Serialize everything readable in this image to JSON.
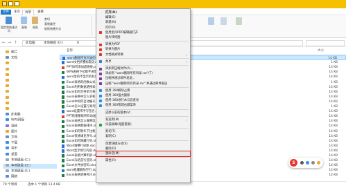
{
  "ribbon_tabs": [
    "文件",
    "主页",
    "共享",
    "查看"
  ],
  "ribbon": {
    "pin_label": "固定到快速访问",
    "copy_label": "复制",
    "paste_label": "粘贴",
    "cut_label": "剪切",
    "copy_path_label": "复制路径",
    "paste_shortcut_label": "粘贴快捷方式"
  },
  "address": {
    "path": [
      "此电脑",
      "本地磁盘 (D:)",
      "8"
    ]
  },
  "nav_pane": [
    {
      "label": "图片",
      "color": "#e8a92e"
    },
    {
      "label": "文档",
      "color": "#6f8fb3"
    },
    {
      "label": "",
      "color": "#e8a92e"
    },
    {
      "label": "",
      "color": "#e8a92e"
    },
    {
      "label": "",
      "color": "#e8a92e"
    },
    {
      "label": "",
      "color": "#e8a92e"
    },
    {
      "label": "",
      "color": "#e8a92e"
    },
    {
      "label": "",
      "color": "#e8a92e"
    },
    {
      "label": "",
      "color": "#e8a92e"
    },
    {
      "label": "",
      "color": "#e8a92e"
    },
    {
      "label": "",
      "color": "#e8a92e"
    },
    {
      "label": "此电脑",
      "color": "#4a90d9"
    },
    {
      "label": "WPS网盘",
      "color": "#3a8ee6"
    },
    {
      "label": "视频",
      "color": "#8a6fd1"
    },
    {
      "label": "图片",
      "color": "#e8a92e"
    },
    {
      "label": "文档",
      "color": "#6f8fb3"
    },
    {
      "label": "下载",
      "color": "#3a8ee6"
    },
    {
      "label": "音乐",
      "color": "#3a8ee6"
    },
    {
      "label": "桌面",
      "color": "#3a8ee6"
    },
    {
      "label": "本地磁盘 (C:)",
      "color": "#9aa7b3"
    },
    {
      "label": "本地磁盘 (D:)",
      "color": "#9aa7b3",
      "selected": true
    },
    {
      "label": "本地磁盘 (E:)",
      "color": "#9aa7b3"
    },
    {
      "label": "网络",
      "color": "#4a90d9"
    }
  ],
  "columns": {
    "name": "名称",
    "size": "大小"
  },
  "files": [
    {
      "name": "word删除所有目录的...docx",
      "size": "14 KB",
      "color": "#2b6fd6",
      "selected": true
    },
    {
      "name": "word文档折叠标题怎么.docx",
      "size": "1 KB",
      "color": "#2b6fd6"
    },
    {
      "name": "PPT如何添加超链接.pptx",
      "size": "14 KB",
      "color": "#d24726"
    },
    {
      "name": "WPS表格下拉数字递增.xlsx",
      "size": "14 KB",
      "color": "#1e7e45"
    },
    {
      "name": "word里的不显示的标记.docx",
      "size": "14 KB",
      "color": "#2b6fd6"
    },
    {
      "name": "Excel表格的函数公式.xlsx",
      "size": "1 KB",
      "color": "#1e7e45"
    },
    {
      "name": "Excel利用数据透视表.xlsx",
      "size": "14 KB",
      "color": "#1e7e45"
    },
    {
      "name": "Excel如何合并单元格.xlsx",
      "size": "14 KB",
      "color": "#1e7e45"
    },
    {
      "name": "excel表格中怎么求和.xlsx",
      "size": "14 KB",
      "color": "#1e7e45"
    },
    {
      "name": "Excel中如何自动编号.xlsx",
      "size": "14 KB",
      "color": "#1e7e45"
    },
    {
      "name": "Excel怎么设置行高列宽.xlsx",
      "size": "1 KB",
      "color": "#1e7e45"
    },
    {
      "name": "word设置带手写签名.docx",
      "size": "14 KB",
      "color": "#2b6fd6"
    },
    {
      "name": "PPT快速删除所有动画.pptx",
      "size": "14 KB",
      "color": "#d24726"
    },
    {
      "name": "Excel表格怎么做筛选.xlsx",
      "size": "14 KB",
      "color": "#1e7e45"
    },
    {
      "name": "Excel表格数据排序.xlsx",
      "size": "14 KB",
      "color": "#1e7e45"
    },
    {
      "name": "Excel如何制作下拉框.xlsx",
      "size": "14 KB",
      "color": "#1e7e45"
    },
    {
      "name": "Excel快速填充序号.xlsx",
      "size": "14 KB",
      "color": "#1e7e45"
    },
    {
      "name": "Excel如何隐藏行列.xlsx",
      "size": "14 KB",
      "color": "#1e7e45"
    },
    {
      "name": "Word调整行间距.docx",
      "size": "14 KB",
      "color": "#2b6fd6"
    },
    {
      "name": "Word显示修订内容.docx",
      "size": "14 KB",
      "color": "#2b6fd6"
    },
    {
      "name": "excel表格计算年龄.xlsx",
      "size": "14 KB",
      "color": "#1e7e45"
    },
    {
      "name": "Excel冻结首行首列.xlsx",
      "size": "14 KB",
      "color": "#1e7e45"
    },
    {
      "name": "Excel文件加密码.xlsx",
      "size": "14 KB",
      "color": "#1e7e45"
    },
    {
      "name": "word批量删除空行.docx",
      "size": "14 KB",
      "color": "#2b6fd6"
    },
    {
      "name": "Excel表格转换PDF.xlsx",
      "size": "14 KB",
      "color": "#1e7e45"
    }
  ],
  "statusbar": {
    "count": "79 个项目",
    "selected": "选中 1 个项目 13.4 KB"
  },
  "context_menu": [
    {
      "label": "打开(O)",
      "icon": "",
      "bold": true
    },
    {
      "label": "编辑(E)",
      "icon": ""
    },
    {
      "label": "新建(N)",
      "icon": ""
    },
    {
      "label": "打印(P)",
      "icon": ""
    },
    {
      "label": "使用金舟PDF编辑器打开",
      "icon": "#d83b2d"
    },
    {
      "label": "图片转纯图",
      "icon": ""
    },
    {
      "sep": true
    },
    {
      "label": "转换为PDF",
      "icon": "#d83b2d"
    },
    {
      "label": "转换为图片",
      "icon": "#d83b2d"
    },
    {
      "label": "文档格式转换",
      "icon": "#d83b2d",
      "arrow": true
    },
    {
      "sep": true
    },
    {
      "label": "共享",
      "icon": "#3c7fc6",
      "arrow": true
    },
    {
      "sep": true
    },
    {
      "label": "添加到压缩文件(A)...",
      "icon": "#7b3f9a"
    },
    {
      "label": "添加到 \"word删除所有目录.rar\"(T)",
      "icon": "#7b3f9a"
    },
    {
      "label": "压缩并通过邮件发送...",
      "icon": "#7b3f9a"
    },
    {
      "label": "压缩 \"word删除所有目录.rar\" 并通过邮件发送",
      "icon": "#7b3f9a"
    },
    {
      "sep": true
    },
    {
      "label": "使用 360解除占用",
      "icon": "#2f8be0"
    },
    {
      "label": "使用 360强力删除",
      "icon": "#2f8be0"
    },
    {
      "label": "使用 360进行木马云查杀",
      "icon": "#2f8be0"
    },
    {
      "label": "使用 360管理右键菜单",
      "icon": "#2f8be0"
    },
    {
      "sep": true
    },
    {
      "label": "还原以前的版本(V)",
      "icon": ""
    },
    {
      "sep": true
    },
    {
      "label": "发送到(N)",
      "icon": "",
      "arrow": true
    },
    {
      "label": "扫描病毒(电脑管家)",
      "icon": "#2d9b4a"
    },
    {
      "sep": true
    },
    {
      "label": "剪切(T)",
      "icon": ""
    },
    {
      "label": "复制(C)",
      "icon": ""
    },
    {
      "sep": true
    },
    {
      "label": "创建快捷方式(S)",
      "icon": ""
    },
    {
      "label": "删除(D)",
      "icon": ""
    },
    {
      "label": "重命名(M)",
      "icon": "",
      "highlight": true
    },
    {
      "sep": true
    },
    {
      "label": "属性(R)",
      "icon": ""
    }
  ],
  "colors": {
    "titlebar": "#f5c000",
    "selection": "#cce8ff",
    "highlight_border": "#e0211b"
  }
}
